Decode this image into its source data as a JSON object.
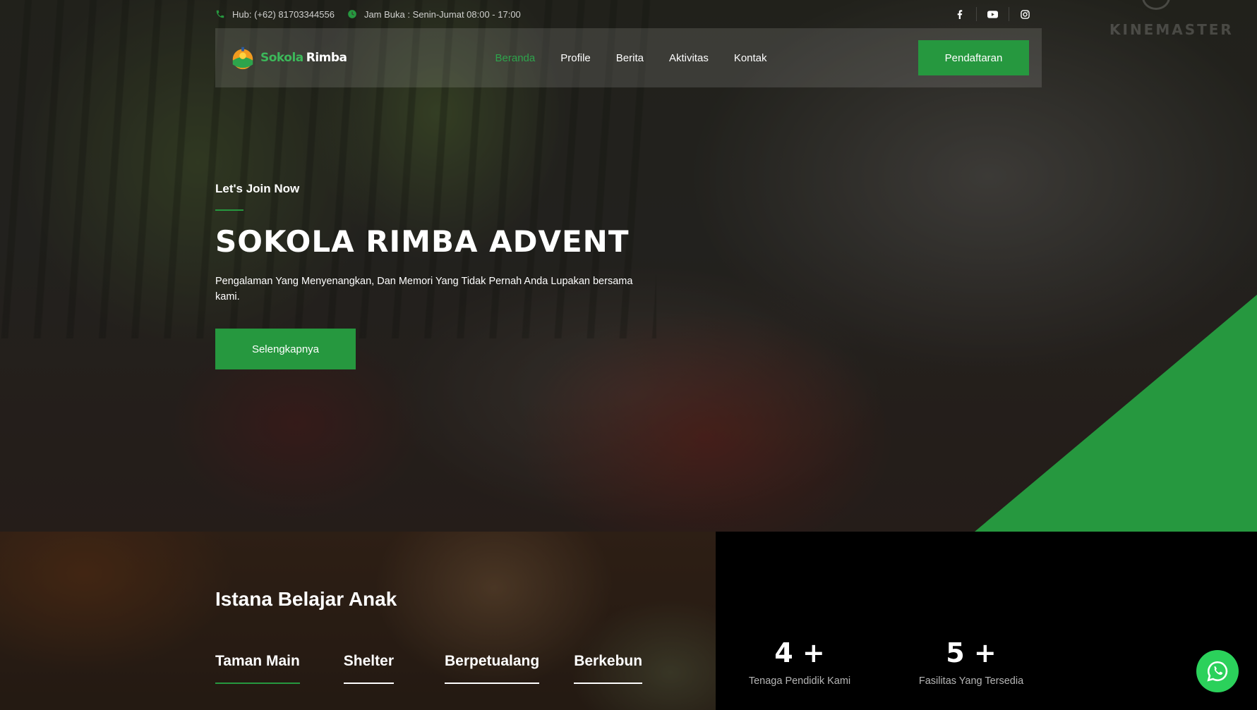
{
  "topbar": {
    "phone": "Hub: (+62) 81703344556",
    "hours": "Jam Buka : Senin-Jumat 08:00 - 17:00",
    "social": [
      "facebook-icon",
      "youtube-icon",
      "instagram-icon"
    ]
  },
  "brand": {
    "name_green": "Sokola",
    "name_white": "Rimba"
  },
  "nav": {
    "items": [
      {
        "label": "Beranda",
        "active": true
      },
      {
        "label": "Profile",
        "active": false
      },
      {
        "label": "Berita",
        "active": false
      },
      {
        "label": "Aktivitas",
        "active": false
      },
      {
        "label": "Kontak",
        "active": false
      }
    ],
    "cta": "Pendaftaran"
  },
  "hero": {
    "subtitle": "Let's Join Now",
    "title": "SOKOLA RIMBA ADVENT",
    "description": "Pengalaman Yang Menyenangkan, Dan Memori Yang Tidak Pernah Anda Lupakan bersama kami.",
    "button": "Selengkapnya"
  },
  "section": {
    "title": "Istana Belajar Anak",
    "tabs": [
      {
        "label": "Taman Main",
        "active": true
      },
      {
        "label": "Shelter",
        "active": false
      },
      {
        "label": "Berpetualang",
        "active": false
      },
      {
        "label": "Berkebun",
        "active": false
      }
    ]
  },
  "stats": [
    {
      "number": "4 +",
      "label": "Tenaga Pendidik Kami"
    },
    {
      "number": "5 +",
      "label": "Fasilitas Yang Tersedia"
    }
  ],
  "colors": {
    "accent": "#26983f",
    "whatsapp": "#2bd15b"
  }
}
